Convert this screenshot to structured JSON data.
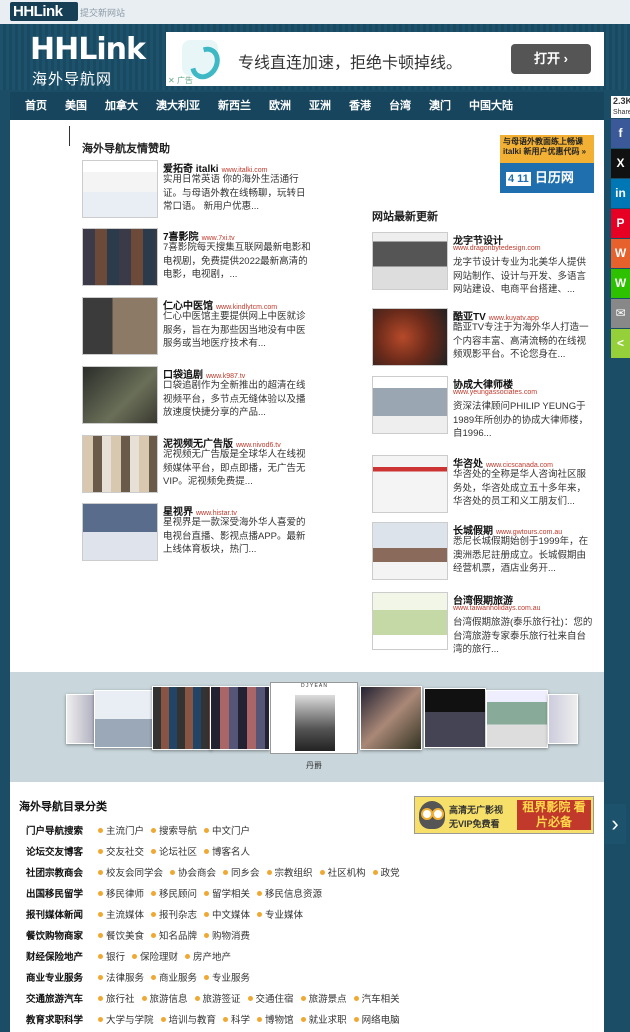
{
  "topbar": {
    "logo": "HHLink",
    "submit_link": "提交新网站"
  },
  "header": {
    "logo_main": "HHLink",
    "logo_sub": "海外导航网",
    "ad": {
      "text": "专线直连加速，拒绝卡顿掉线。",
      "button": "打开",
      "tag": "广告"
    }
  },
  "nav": [
    "首页",
    "美国",
    "加拿大",
    "澳大利亚",
    "新西兰",
    "欧洲",
    "亚洲",
    "香港",
    "台湾",
    "澳门",
    "中国大陆"
  ],
  "share": {
    "count": "2.3K",
    "label": "Shares",
    "buttons": [
      "f",
      "X",
      "in",
      "P",
      "W",
      "W",
      "✉",
      "<"
    ]
  },
  "sponsors": {
    "title": "海外导航友情赞助",
    "items": [
      {
        "name": "爱拓奇 italki",
        "url": "www.italki.com",
        "desc": "实用日常英语 你的海外生活通行证。与母语外教在线畅聊，玩转日常口语。 新用户优惠..."
      },
      {
        "name": "7喜影院",
        "url": "www.7xi.tv",
        "desc": "7喜影院每天搜集互联网最新电影和电视剧，免费提供2022最新高清的电影，电视剧，..."
      },
      {
        "name": "仁心中医馆",
        "url": "www.kindlytcm.com",
        "desc": "仁心中医馆主要提供网上中医就诊服务，旨在为那些因当地没有中医服务或当地医疗技术有..."
      },
      {
        "name": "口袋追剧",
        "url": "www.k987.tv",
        "desc": "口袋追剧作为全新推出的超清在线视频平台，多节点无缝体验以及播放速度快捷分享的产品..."
      },
      {
        "name": "泥视频无广告版",
        "url": "www.nivod6.tv",
        "desc": "泥视频无广告版是全球华人在线视频媒体平台，即点即播，无广告无VIP。泥视频免费提..."
      },
      {
        "name": "星视界",
        "url": "www.histar.tv",
        "desc": "星视界是一款深受海外华人喜爱的电视台直播、影视点播APP。最新上线体育板块，热门..."
      }
    ]
  },
  "calendar_ad": {
    "top": "与母语外教面练上畅课 italki 新用户优惠代码 »",
    "day": "4 11",
    "label": "日历网"
  },
  "updates": {
    "title": "网站最新更新",
    "items": [
      {
        "name": "龙字节设计",
        "url": "www.dragonbytedesign.com",
        "desc": "龙字节设计专业为北美华人提供网站制作、设计与开发、多语言网站建设、电商平台搭建、..."
      },
      {
        "name": "酷亚TV",
        "url": "www.kuyatv.app",
        "desc": "酷亚TV专注于为海外华人打造一个内容丰富、高清流畅的在线视频观影平台。不论您身在..."
      },
      {
        "name": "协成大律师楼",
        "url": "www.yeungassociates.com",
        "desc": "资深法律顾问PHILIP YEUNG于1989年所创办的协成大律师楼，自1996..."
      },
      {
        "name": "华咨处",
        "url": "www.cicscanada.com",
        "desc": "华咨处的全称是华人咨询社区服务处，华咨处成立五十多年来，华咨处的员工和义工朋友们..."
      },
      {
        "name": "长城假期",
        "url": "www.gwtours.com.au",
        "desc": "悉尼长城假期始创于1999年，在澳洲悉尼註册成立。长城假期由经营机票，酒店业务开..."
      },
      {
        "name": "台湾假期旅游",
        "url": "www.taiwanholidays.com.au",
        "desc": "台湾假期旅游(泰乐旅行社)：您的台湾旅游专家泰乐旅行社来自台湾的旅行..."
      }
    ]
  },
  "carousel": {
    "caption": "丹爵",
    "center_label": "D J Y E A N"
  },
  "directory": {
    "title": "海外导航目录分类",
    "rows": [
      {
        "cat": "门户导航搜索",
        "items": [
          "主流门户",
          "搜索导航",
          "中文门户"
        ]
      },
      {
        "cat": "论坛交友博客",
        "items": [
          "交友社交",
          "论坛社区",
          "博客名人"
        ]
      },
      {
        "cat": "社团宗教商会",
        "items": [
          "校友会同学会",
          "协会商会",
          "同乡会",
          "宗教组织",
          "社区机构",
          "政党"
        ]
      },
      {
        "cat": "出国移民留学",
        "items": [
          "移民律师",
          "移民顾问",
          "留学相关",
          "移民信息资源"
        ]
      },
      {
        "cat": "报刊媒体新闻",
        "items": [
          "主流媒体",
          "报刊杂志",
          "中文媒体",
          "专业媒体"
        ]
      },
      {
        "cat": "餐饮购物商家",
        "items": [
          "餐饮美食",
          "知名品牌",
          "购物消费"
        ]
      },
      {
        "cat": "财经保险地产",
        "items": [
          "银行",
          "保险理财",
          "房产地产"
        ]
      },
      {
        "cat": "商业专业服务",
        "items": [
          "法律服务",
          "商业服务",
          "专业服务"
        ]
      },
      {
        "cat": "交通旅游汽车",
        "items": [
          "旅行社",
          "旅游信息",
          "旅游签证",
          "交通住宿",
          "旅游景点",
          "汽车相关"
        ]
      },
      {
        "cat": "教育求职科学",
        "items": [
          "大学与学院",
          "培训与教育",
          "科学",
          "博物馆",
          "就业求职",
          "网络电脑"
        ]
      }
    ],
    "ad": {
      "line1": "高清无广影视",
      "line2": "无VIP免费看",
      "line3": "租界影院 看片必备"
    }
  },
  "colors": {
    "header_bg": "#1b4d66",
    "nav_bg": "#17455d",
    "accent_red": "#c0392b",
    "bullet": "#f0a830"
  }
}
